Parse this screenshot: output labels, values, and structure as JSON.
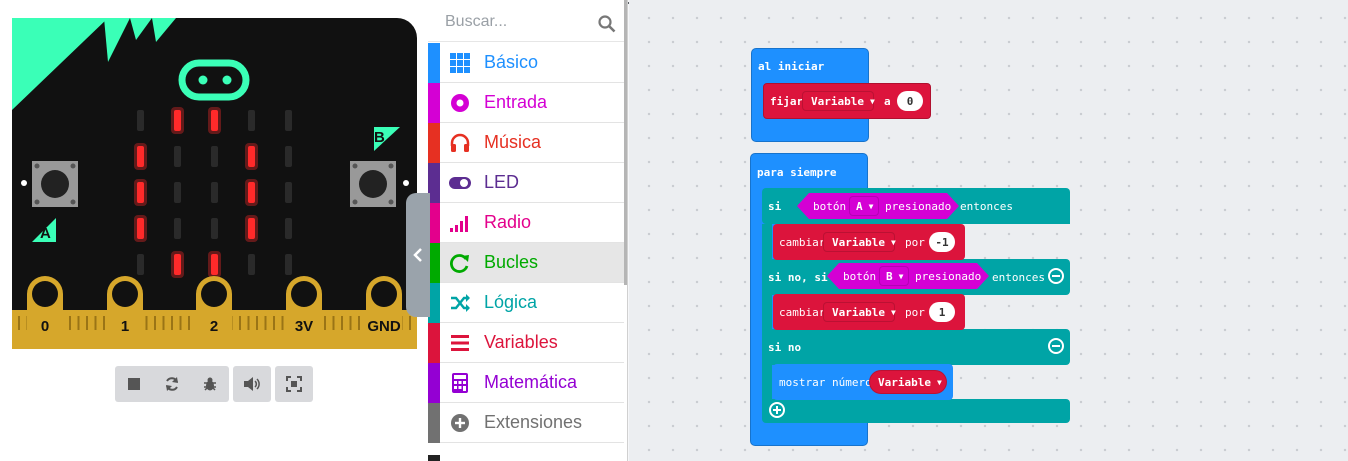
{
  "simulator": {
    "pins": [
      "0",
      "1",
      "2",
      "3V",
      "GND"
    ],
    "button_a_label": "A",
    "button_b_label": "B",
    "led_matrix": [
      [
        0,
        1,
        1,
        0,
        0
      ],
      [
        1,
        0,
        0,
        1,
        0
      ],
      [
        1,
        0,
        0,
        1,
        0
      ],
      [
        1,
        0,
        0,
        1,
        0
      ],
      [
        0,
        1,
        1,
        0,
        0
      ]
    ],
    "controls": [
      "stop-icon",
      "restart-icon",
      "debug-icon",
      "sound-icon",
      "fullscreen-icon"
    ]
  },
  "toolbox": {
    "search_placeholder": "Buscar...",
    "categories": [
      {
        "label": "Básico",
        "color": "#1e90ff",
        "icon": "grid-icon"
      },
      {
        "label": "Entrada",
        "color": "#d400d4",
        "icon": "target-icon"
      },
      {
        "label": "Música",
        "color": "#e63022",
        "icon": "headphones-icon"
      },
      {
        "label": "LED",
        "color": "#5c2d91",
        "icon": "toggle-icon"
      },
      {
        "label": "Radio",
        "color": "#e3008c",
        "icon": "signal-icon"
      },
      {
        "label": "Bucles",
        "color": "#00aa00",
        "icon": "loop-icon"
      },
      {
        "label": "Lógica",
        "color": "#00a4a6",
        "icon": "shuffle-icon"
      },
      {
        "label": "Variables",
        "color": "#dc143c",
        "icon": "list-icon"
      },
      {
        "label": "Matemática",
        "color": "#9400d3",
        "icon": "calculator-icon"
      },
      {
        "label": "Extensiones",
        "color": "#717171",
        "icon": "plus-circle-icon"
      }
    ]
  },
  "blocks": {
    "on_start": {
      "title": "al iniciar",
      "set": "fijar",
      "variable": "Variable",
      "to": "a",
      "value": "0"
    },
    "forever": {
      "title": "para siempre",
      "if": "si",
      "button": "botón",
      "button_a": "A",
      "pressed": "presionado",
      "then": "entonces",
      "change": "cambiar",
      "variable": "Variable",
      "by": "por",
      "value_minus": "-1",
      "else_if": "si no, si",
      "button_b": "B",
      "value_plus": "1",
      "else": "si no",
      "show_number": "mostrar número"
    }
  },
  "colors": {
    "loops": "#1e90ff",
    "logic": "#00a4a6",
    "variables": "#dc143c",
    "input": "#d400d4",
    "basic": "#1e90ff",
    "led_on": "#ff2a2a",
    "board": "#111111",
    "accent": "#3affb7",
    "pad": "#d6a72b"
  }
}
